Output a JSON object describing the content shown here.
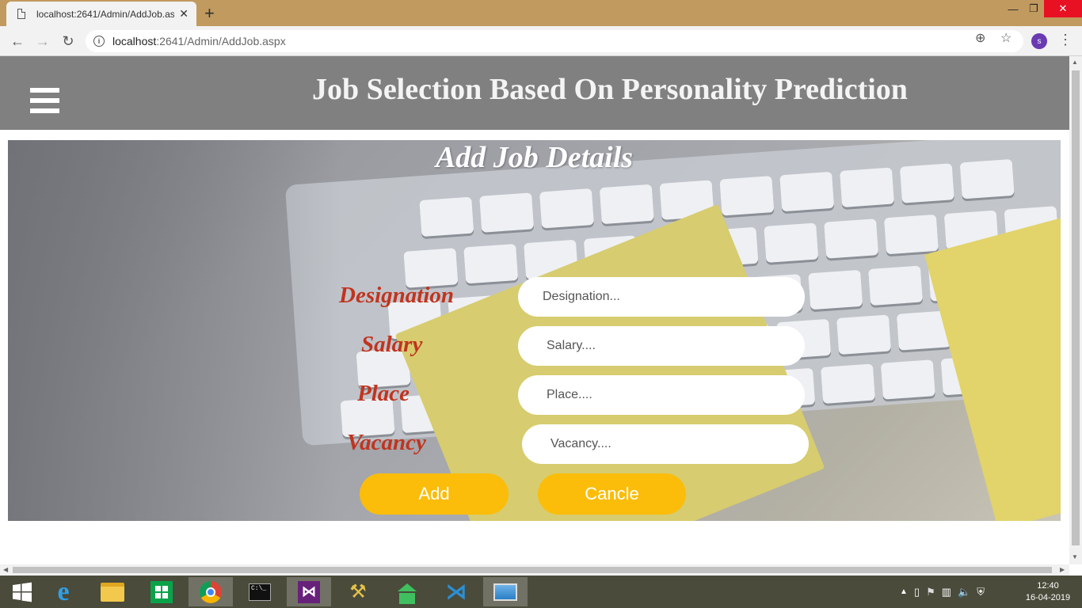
{
  "browser": {
    "tab_title": "localhost:2641/Admin/AddJob.as",
    "url_host": "localhost",
    "url_path": ":2641/Admin/AddJob.aspx",
    "profile_initial": "s"
  },
  "page": {
    "site_title": "Job Selection Based On Personality Prediction",
    "form_title": "Add Job Details",
    "fields": {
      "designation_label": "Designation",
      "designation_placeholder": "Designation...",
      "salary_label": "Salary",
      "salary_placeholder": "Salary....",
      "place_label": "Place",
      "place_placeholder": "Place....",
      "vacancy_label": "Vacancy",
      "vacancy_placeholder": "Vacancy...."
    },
    "buttons": {
      "add": "Add",
      "cancel": "Cancle"
    },
    "colors": {
      "header_bg": "#808080",
      "label": "#c0341f",
      "button": "#fbbd0a"
    }
  },
  "taskbar": {
    "items": [
      "start-icon",
      "internet-explorer-icon",
      "file-explorer-icon",
      "store-icon",
      "chrome-icon",
      "command-prompt-icon",
      "visual-studio-icon",
      "tools-icon",
      "house-app-icon",
      "vscode-icon",
      "photos-icon"
    ],
    "time": "12:40",
    "date": "16-04-2019"
  }
}
